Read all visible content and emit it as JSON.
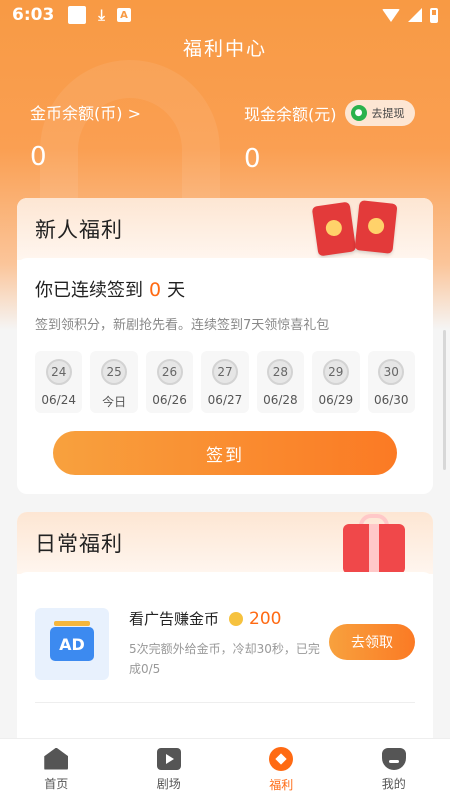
{
  "status_bar": {
    "time": "6:03",
    "a_glyph": "A"
  },
  "header": {
    "title": "福利中心"
  },
  "balances": {
    "coin_label": "金币余额(币) >",
    "coin_value": "0",
    "cash_label": "现金余额(元)",
    "cash_value": "0",
    "withdraw_label": "去提现"
  },
  "newbie": {
    "title": "新人福利",
    "streak_prefix": "你已连续签到",
    "streak_days": "0",
    "streak_suffix": "天",
    "hint": "签到领积分，新剧抢先看。连续签到7天领惊喜礼包",
    "days": [
      {
        "num": "24",
        "date": "06/24"
      },
      {
        "num": "25",
        "date": "今日"
      },
      {
        "num": "26",
        "date": "06/26"
      },
      {
        "num": "27",
        "date": "06/27"
      },
      {
        "num": "28",
        "date": "06/28"
      },
      {
        "num": "29",
        "date": "06/29"
      },
      {
        "num": "30",
        "date": "06/30"
      }
    ],
    "checkin_label": "签到"
  },
  "daily": {
    "title": "日常福利",
    "task": {
      "thumb_label": "AD",
      "title": "看广告赚金币",
      "reward": "200",
      "desc": "5次完额外给金币，冷却30秒，已完成0/5",
      "claim_label": "去领取"
    }
  },
  "tabs": [
    {
      "label": "首页",
      "icon": "home-icon"
    },
    {
      "label": "剧场",
      "icon": "theater-icon"
    },
    {
      "label": "福利",
      "icon": "welfare-icon"
    },
    {
      "label": "我的",
      "icon": "mine-icon"
    }
  ],
  "colors": {
    "accent": "#ff6a13",
    "header_orange": "#f89a44"
  }
}
